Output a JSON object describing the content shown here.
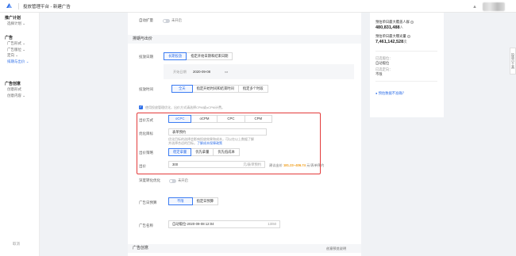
{
  "header": {
    "title": "投放管理平台 - 新建广告"
  },
  "sidebar": {
    "groups": [
      {
        "title": "推广计划",
        "items": [
          {
            "label": "选择计划 ⌄",
            "active": false
          }
        ]
      },
      {
        "title": "广告",
        "items": [
          {
            "label": "广告形式 ⌄",
            "active": false
          },
          {
            "label": "广告版位 ⌄",
            "active": false
          },
          {
            "label": "定向 ⌄",
            "active": false
          },
          {
            "label": "排期与出价 ⌄",
            "active": true
          }
        ]
      },
      {
        "title": "广告创意",
        "items": [
          {
            "label": "创意形式",
            "active": false
          },
          {
            "label": "创意内容 ⌄",
            "active": false
          }
        ]
      }
    ],
    "footer": "取消"
  },
  "main": {
    "auto_expand": {
      "label": "自动扩量",
      "value": "未开启"
    },
    "section_schedule": "排期与出价",
    "date": {
      "label": "投放日期",
      "options": [
        "长期投放",
        "指定开始日期和结束日期"
      ],
      "start_label": "开始日期",
      "start_value": "2020-09-08"
    },
    "time": {
      "label": "投放时间",
      "options": [
        "全天",
        "指定开始时间和结束时间",
        "指定多个时段"
      ]
    },
    "ocpm_note": "使用投放管理优化，出价方式请选择CPM或oCPM计费。",
    "bid_method": {
      "label": "出价方式",
      "options": [
        "oCPC",
        "oCPM",
        "CPC",
        "CPM"
      ]
    },
    "opt_goal": {
      "label": "优化目标",
      "value": "表单预约",
      "note1": "优化目标的选择会影响投放效果和成本，可以在以上数据了解",
      "note2": "并选择合适的目标。",
      "link": "了解成本保障政策"
    },
    "strategy": {
      "label": "出价策略",
      "options": [
        "稳定拿量",
        "优先拿量",
        "优先低成本"
      ]
    },
    "bid": {
      "label": "出价",
      "value": "300",
      "unit": "元/表单预约",
      "suggest_prefix": "建议出价",
      "suggest_range": "181.23~406.74",
      "suggest_suffix": "元/表单预约"
    },
    "deep_opt": {
      "label": "深度转化优化",
      "value": "未开启"
    },
    "budget": {
      "label": "广告日预算",
      "options": [
        "不限",
        "指定日预算"
      ]
    },
    "ad_name": {
      "label": "广告名称",
      "value": "自动版位-2020-09-08 12:04",
      "count": "13/60"
    },
    "section_creative": "广告创意",
    "creative_link": "创意预览说明"
  },
  "right_panel": {
    "reach_label": "预估单日最大覆盖人群",
    "reach_value": "480,831,488",
    "reach_unit": "人",
    "expose_label": "预估单日最大曝光量",
    "expose_value": "7,461,142,528",
    "expose_unit": "次",
    "placement_label": "已选版位：",
    "placement_value": "自动版位",
    "targeting_label": "已选定向：",
    "targeting_value": "不限",
    "help": "预估数据不准确？"
  },
  "side_tab": "投放小工具"
}
